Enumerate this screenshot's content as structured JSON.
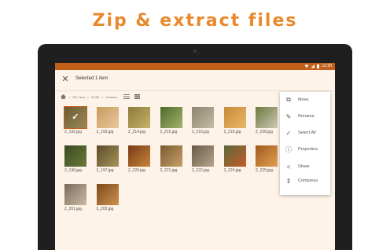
{
  "headline": "Zip & extract files",
  "status_bar": {
    "time": "12:30"
  },
  "toolbar": {
    "close_icon": "close-icon",
    "selection_title": "Selected 1 item"
  },
  "path": {
    "crumbs": [
      "SD Card",
      "DCIM",
      "Camera"
    ],
    "separator": ">"
  },
  "files": [
    {
      "name": "2_192.jpg",
      "selected": true,
      "colors": [
        "#6b5a33",
        "#9a8a55"
      ]
    },
    {
      "name": "2_193.jpg",
      "selected": false,
      "colors": [
        "#c89a60",
        "#e8c99a"
      ]
    },
    {
      "name": "2_214.jpg",
      "selected": false,
      "colors": [
        "#8a7a3a",
        "#c9b36a"
      ]
    },
    {
      "name": "2_215.jpg",
      "selected": false,
      "colors": [
        "#4f6a2c",
        "#a4b36b"
      ]
    },
    {
      "name": "2_216.jpg",
      "selected": false,
      "colors": [
        "#8a8470",
        "#c4bca2"
      ]
    },
    {
      "name": "2_219.jpg",
      "selected": false,
      "colors": [
        "#c98a3a",
        "#e6b866"
      ]
    },
    {
      "name": "2_228.jpg",
      "selected": false,
      "colors": [
        "#6a7a3a",
        "#d0c8b8"
      ]
    },
    {
      "name": "2_196.jpg",
      "selected": false,
      "colors": [
        "#3a4a22",
        "#6a7a3a"
      ]
    },
    {
      "name": "2_197.jpg",
      "selected": false,
      "colors": [
        "#5a4a2a",
        "#a8955a"
      ]
    },
    {
      "name": "2_220.jpg",
      "selected": false,
      "colors": [
        "#7a3a16",
        "#c7853a"
      ]
    },
    {
      "name": "2_221.jpg",
      "selected": false,
      "colors": [
        "#7a5a30",
        "#c8a06a"
      ]
    },
    {
      "name": "2_222.jpg",
      "selected": false,
      "colors": [
        "#6a5a4a",
        "#b5a58a"
      ]
    },
    {
      "name": "2_224.jpg",
      "selected": false,
      "colors": [
        "#5a6a3a",
        "#c75a2a"
      ]
    },
    {
      "name": "2_225.jpg",
      "selected": false,
      "colors": [
        "#a05a20",
        "#e0a050"
      ]
    },
    {
      "name": "2_201.jpg",
      "selected": false,
      "colors": [
        "#7a6a5a",
        "#cbbba5"
      ]
    },
    {
      "name": "2_202.jpg",
      "selected": false,
      "colors": [
        "#7a4a1a",
        "#d09050"
      ]
    }
  ],
  "menu": [
    {
      "label": "Move",
      "icon": "copy-icon",
      "glyph": "⧉"
    },
    {
      "label": "Rename",
      "icon": "pencil-icon",
      "glyph": "✎"
    },
    {
      "label": "Select All",
      "icon": "double-check-icon",
      "glyph": "✓"
    },
    {
      "label": "Properties",
      "icon": "info-icon",
      "glyph": "ⓘ"
    },
    {
      "label": "Share",
      "icon": "share-icon",
      "glyph": "<"
    },
    {
      "label": "Compress",
      "icon": "compress-icon",
      "glyph": "⇕"
    }
  ]
}
